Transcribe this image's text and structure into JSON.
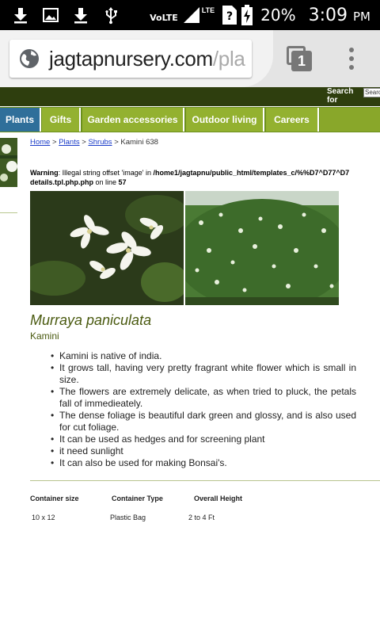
{
  "status_bar": {
    "network": "VoLTE",
    "lte": "LTE",
    "battery_percent": "20%",
    "time": "3:09",
    "ampm": "PM"
  },
  "browser": {
    "url_main": "jagtapnursery.com",
    "url_fade": "/pla",
    "tab_count": "1"
  },
  "site_header": {
    "search_label": "Search for",
    "search_value": "Search"
  },
  "nav": {
    "items": [
      "Plants",
      "Gifts",
      "Garden accessories",
      "Outdoor living",
      "Careers"
    ],
    "active": "Plants",
    "colors": {
      "active": "#2f6f9a",
      "item": "#93b130",
      "bar": "#6b8f1c"
    }
  },
  "breadcrumb": {
    "links": [
      "Home",
      "Plants",
      "Shrubs"
    ],
    "separator": ">",
    "current": "Kamini 638"
  },
  "warning": {
    "label": "Warning",
    "message": ": Illegal string offset 'image' in ",
    "path": "/home1/jagtapnu/public_html/templates_c/%%D7^D77^D7",
    "file": "details.tpl.php.php",
    "on_line": " on line ",
    "line": "57"
  },
  "plant": {
    "latin_name": "Murraya paniculata",
    "common_name": "Kamini",
    "facts": [
      "Kamini is native of india.",
      "It grows tall, having very pretty fragrant white flower which is small in size.",
      "The flowers are extremely delicate, as when tried to pluck, the petals fall of immedieately.",
      "The dense foliage is beautiful dark green and glossy, and is also used for cut foliage.",
      "It can be used as hedges and for screening plant",
      "it need sunlight",
      "It can also be used for making Bonsai's."
    ]
  },
  "specs": {
    "headers": [
      "Container size",
      "Container Type",
      "Overall Height"
    ],
    "values": [
      "10 x 12",
      "Plastic Bag",
      "2 to 4 Ft"
    ]
  }
}
